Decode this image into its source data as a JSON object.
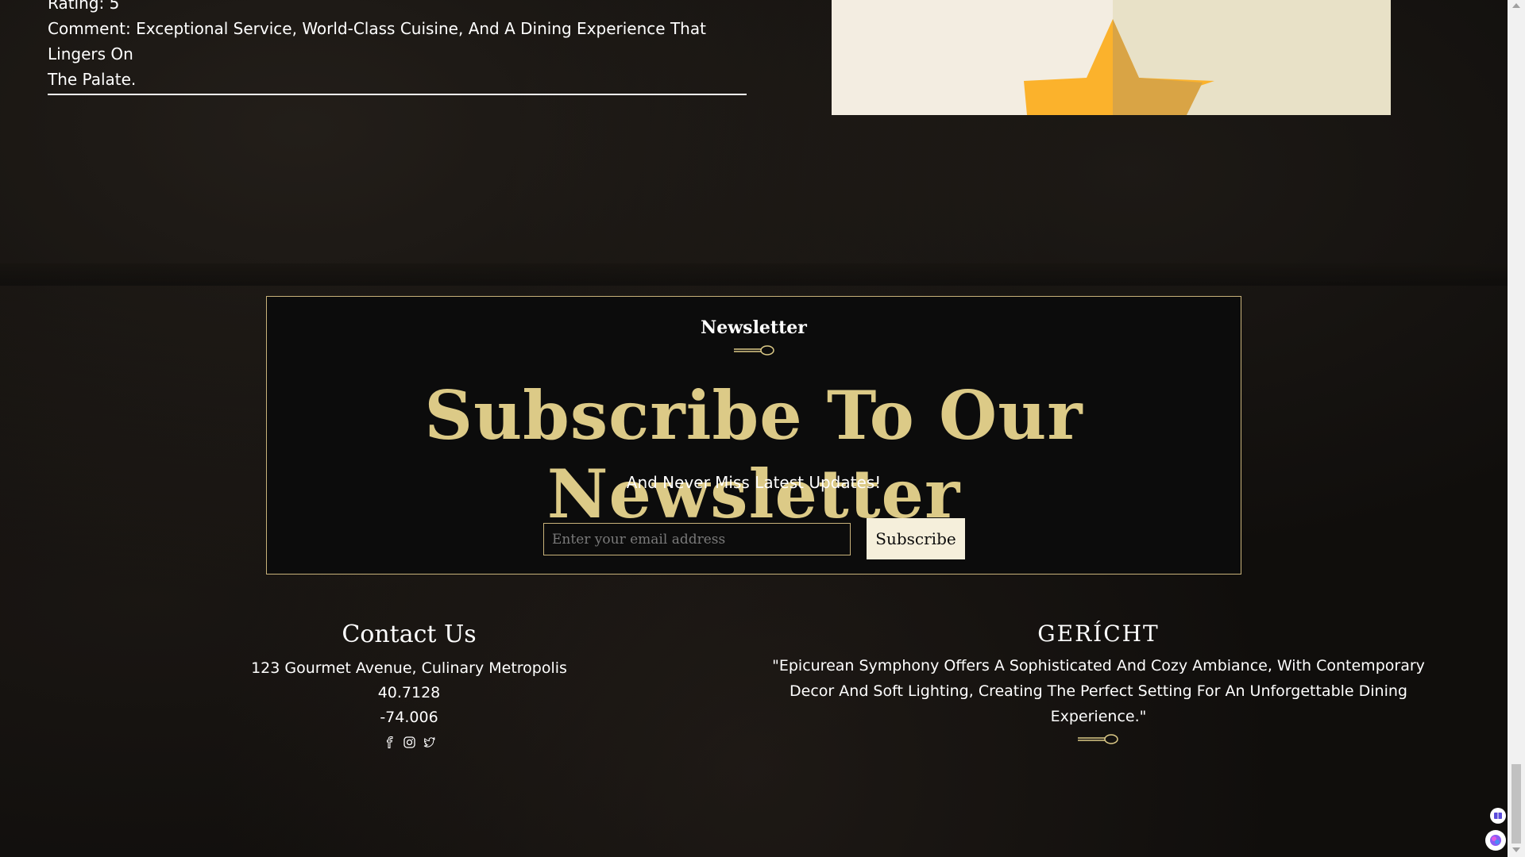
{
  "review": {
    "rating": "Rating: 5",
    "comment_line1": "Comment: Exceptional Service, World-Class Cuisine, And A Dining Experience That Lingers On",
    "comment_line2": "The Palate."
  },
  "newsletter": {
    "subtitle": "Newsletter",
    "title": "Subscribe To Our Newsletter",
    "description": "And Never Miss Latest Updates!",
    "email_placeholder": "Enter your email address",
    "subscribe_label": "Subscribe"
  },
  "contact": {
    "heading": "Contact Us",
    "address": "123 Gourmet Avenue, Culinary Metropolis",
    "latitude": "40.7128",
    "longitude": "-74.006",
    "social_icons": [
      "facebook-icon",
      "instagram-icon",
      "twitter-icon"
    ]
  },
  "brand": {
    "name": "GERÍCHT",
    "quote": "\"Epicurean Symphony Offers A Sophisticated And Cozy Ambiance, With Contemporary Decor And Soft Lighting, Creating The Perfect Setting For An Unforgettable Dining Experience.\""
  },
  "colors": {
    "gold": "#dcca87",
    "background": "#0c0c0c",
    "button_bg": "#f5efdb"
  }
}
